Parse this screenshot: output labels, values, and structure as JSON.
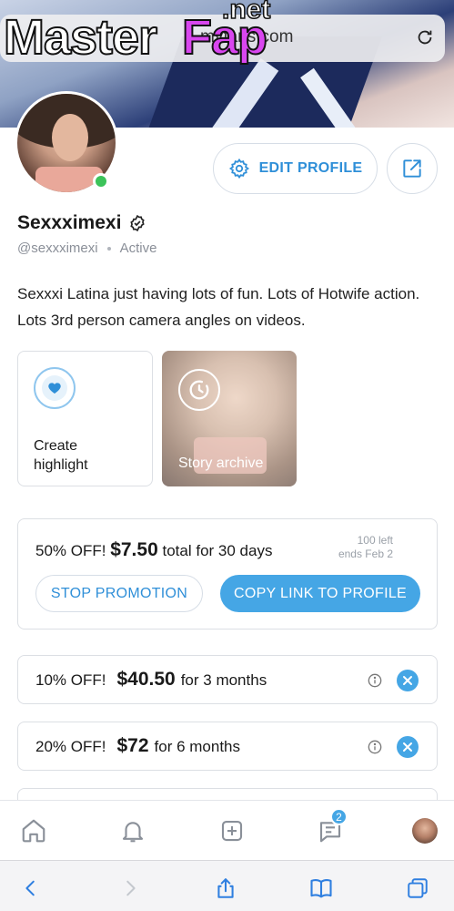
{
  "browser": {
    "url": "myfans.com",
    "watermark_master": "Master",
    "watermark_fap": "Fap",
    "watermark_net": ".net"
  },
  "profile": {
    "edit_label": "EDIT PROFILE",
    "name": "Sexxximexi",
    "handle": "@sexxximexi",
    "status": "Active",
    "bio": "Sexxxi Latina just having lots of fun. Lots of Hotwife action. Lots 3rd person camera angles on videos."
  },
  "highlights": {
    "create_label": "Create highlight",
    "story_label": "Story archive"
  },
  "promotion": {
    "discount": "50% OFF!",
    "price": "$7.50",
    "terms": "total for 30 days",
    "left": "100 left",
    "ends": "ends Feb 2",
    "stop_label": "STOP PROMOTION",
    "copy_label": "COPY LINK TO PROFILE"
  },
  "offers": [
    {
      "discount": "10% OFF!",
      "price": "$40.50",
      "period": "for 3 months"
    },
    {
      "discount": "20% OFF!",
      "price": "$72",
      "period": "for 6 months"
    }
  ],
  "nav": {
    "messages_badge": "2"
  },
  "colors": {
    "accent": "#45a6e5",
    "accent_text": "#2f8fd8",
    "online": "#3cc35a"
  }
}
